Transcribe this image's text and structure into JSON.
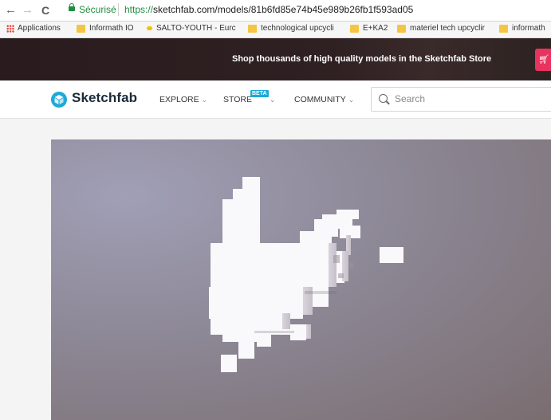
{
  "browser": {
    "back_icon": "←",
    "forward_icon": "→",
    "reload_icon": "C",
    "secure_label": "Sécurisé",
    "url_scheme": "https://",
    "url_rest": "sketchfab.com/models/81b6fd85e74b45e989b26fb1f593ad05"
  },
  "bookmarks": {
    "items": [
      {
        "label": "Applications"
      },
      {
        "label": "Informath IO"
      },
      {
        "label": "SALTO-YOUTH - Eurc"
      },
      {
        "label": "technological upcycli"
      },
      {
        "label": "E+KA2"
      },
      {
        "label": "materiel tech upcyclir"
      },
      {
        "label": "informath"
      }
    ]
  },
  "banner": {
    "text": "Shop thousands of high quality models in the Sketchfab Store",
    "cart_icon": "cart-icon"
  },
  "header": {
    "logo_text": "Sketchfab",
    "nav": [
      {
        "label": "EXPLORE"
      },
      {
        "label": "STORE"
      },
      {
        "label": "COMMUNITY"
      }
    ],
    "beta_badge": "BETA",
    "search_placeholder": "Search"
  },
  "colors": {
    "brand": "#1caad9",
    "secure_green": "#1e8e3e",
    "cart_pink": "#e8335f"
  }
}
